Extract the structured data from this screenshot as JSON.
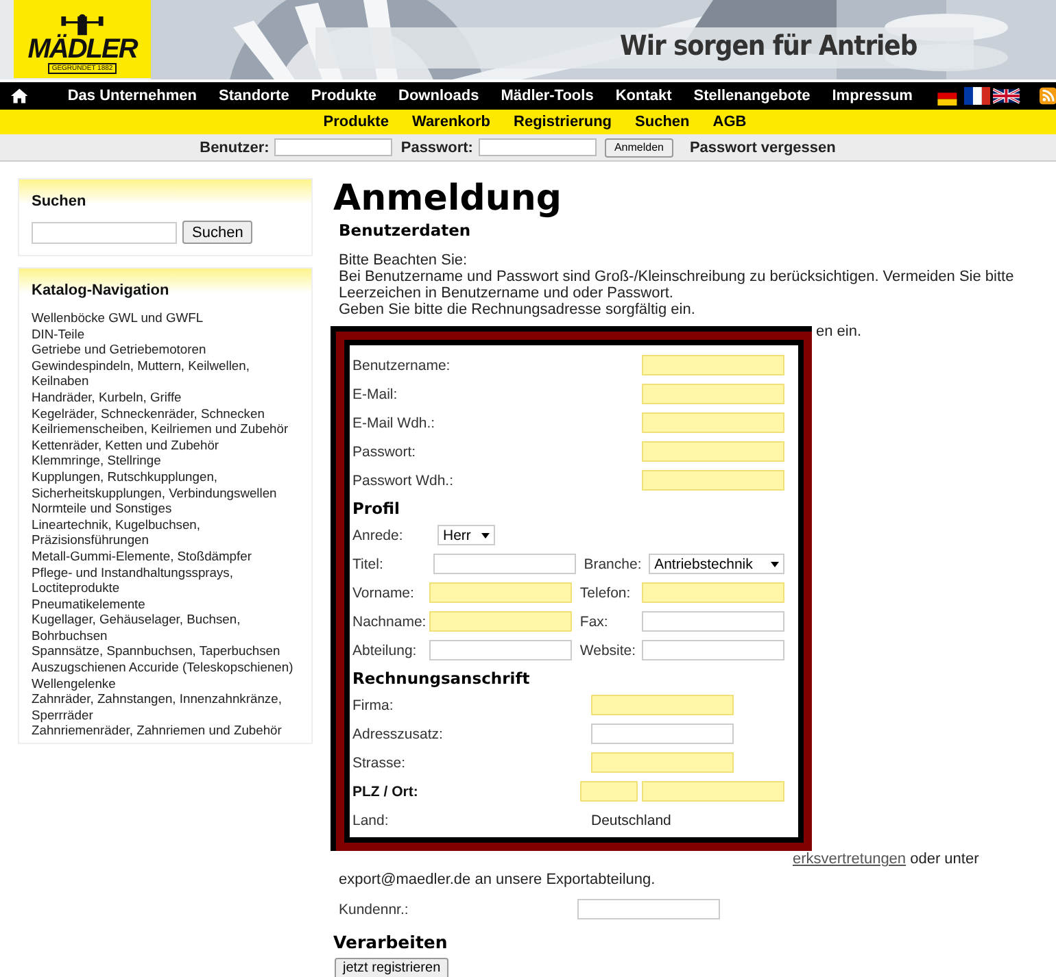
{
  "header": {
    "brand": "MÄDLER",
    "founded": "GEGRÜNDET 1882",
    "slogan": "Wir sorgen für Antrieb"
  },
  "nav": [
    "Das Unternehmen",
    "Standorte",
    "Produkte",
    "Downloads",
    "Mädler-Tools",
    "Kontakt",
    "Stellenangebote",
    "Impressum"
  ],
  "subnav": [
    "Produkte",
    "Warenkorb",
    "Registrierung",
    "Suchen",
    "AGB"
  ],
  "login_bar": {
    "user_label": "Benutzer:",
    "password_label": "Passwort:",
    "button": "Anmelden",
    "forgot": "Passwort vergessen"
  },
  "sidebar": {
    "search": {
      "title": "Suchen",
      "button": "Suchen"
    },
    "catalog": {
      "title": "Katalog-Navigation",
      "items": [
        "Wellenböcke GWL und GWFL",
        "DIN-Teile",
        "Getriebe und Getriebemotoren",
        "Gewindespindeln, Muttern, Keilwellen, Keilnaben",
        "Handräder, Kurbeln, Griffe",
        "Kegelräder, Schneckenräder, Schnecken",
        "Keilriemenscheiben, Keilriemen und Zubehör",
        "Kettenräder, Ketten und Zubehör",
        "Klemmringe, Stellringe",
        "Kupplungen, Rutschkupplungen, Sicherheitskupplungen, Verbindungswellen",
        "Normteile und Sonstiges",
        "Lineartechnik, Kugelbuchsen, Präzisionsführungen",
        "Metall-Gummi-Elemente, Stoßdämpfer",
        "Pflege- und Instandhaltungssprays, Loctiteprodukte",
        "Pneumatikelemente",
        "Kugellager, Gehäuselager, Buchsen, Bohrbuchsen",
        "Spannsätze, Spannbuchsen, Taperbuchsen",
        "Auszugschienen Accuride (Teleskopschienen)",
        "Wellengelenke",
        "Zahnräder, Zahnstangen, Innenzahnkränze, Sperrräder",
        "Zahnriemenräder, Zahnriemen und Zubehör"
      ]
    }
  },
  "main": {
    "title": "Anmeldung",
    "section": "Benutzerdaten",
    "notes": [
      "Bitte Beachten Sie:",
      "Bei Benutzername und Passwort sind Groß-/Kleinschreibung zu berücksichtigen. Vermeiden Sie bitte Leerzeichen in Benutzername und oder Passwort.",
      "Geben Sie bitte die Rechnungsadresse sorgfältig ein."
    ],
    "note_fragment": "en ein.",
    "account": [
      {
        "label": "Benutzername:",
        "required": true
      },
      {
        "label": "E-Mail:",
        "required": true
      },
      {
        "label": "E-Mail Wdh.:",
        "required": true
      },
      {
        "label": "Passwort:",
        "required": true
      },
      {
        "label": "Passwort Wdh.:",
        "required": true
      }
    ],
    "profile": {
      "title": "Profil",
      "salutation": {
        "label": "Anrede:",
        "value": "Herr"
      },
      "rows": [
        [
          {
            "label": "Titel:",
            "kind": "text",
            "required": false
          },
          {
            "label": "Branche:",
            "kind": "select",
            "value": "Antriebstechnik",
            "required": false
          }
        ],
        [
          {
            "label": "Vorname:",
            "kind": "text",
            "required": true
          },
          {
            "label": "Telefon:",
            "kind": "text",
            "required": true
          }
        ],
        [
          {
            "label": "Nachname:",
            "kind": "text",
            "required": true
          },
          {
            "label": "Fax:",
            "kind": "text",
            "required": false
          }
        ],
        [
          {
            "label": "Abteilung:",
            "kind": "text",
            "required": false
          },
          {
            "label": "Website:",
            "kind": "text",
            "required": false
          }
        ]
      ]
    },
    "billing": {
      "title": "Rechnungsanschrift",
      "rows": [
        {
          "label": "Firma:",
          "kind": "text",
          "required": true
        },
        {
          "label": "Adresszusatz:",
          "kind": "text",
          "required": false
        },
        {
          "label": "Strasse:",
          "kind": "text",
          "required": true
        },
        {
          "label": "PLZ / Ort:",
          "kind": "split",
          "required": true
        },
        {
          "label": "Land:",
          "kind": "static",
          "value": "Deutschland"
        }
      ]
    },
    "export_link": "erksvertretungen",
    "export_after": " oder unter",
    "export_line": "export@maedler.de an unsere Exportabteilung.",
    "customer_label": "Kundennr.:",
    "submit_title": "Verarbeiten",
    "submit_button": "jetzt registrieren"
  }
}
